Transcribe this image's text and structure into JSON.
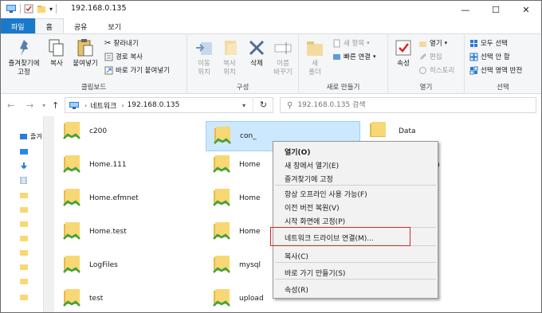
{
  "window": {
    "title": "192.168.0.135",
    "minimize_glyph": "—",
    "maximize_glyph": "☐",
    "close_glyph": "✕"
  },
  "ribbon_tabs": [
    {
      "label": "파일"
    },
    {
      "label": "홈"
    },
    {
      "label": "공유"
    },
    {
      "label": "보기"
    }
  ],
  "ribbon": {
    "clipboard": {
      "label": "클립보드",
      "pin": "즐겨찾기에\n고정",
      "copy": "복사",
      "paste": "붙여넣기",
      "cut": "잘라내기",
      "copy_path": "경로 복사",
      "paste_shortcut": "바로 가기 붙여넣기"
    },
    "organize": {
      "label": "구성",
      "move_to": "이동\n위치",
      "copy_to": "복사\n위치",
      "delete": "삭제",
      "rename": "이름\n바꾸기"
    },
    "new": {
      "label": "새로 만들기",
      "new_folder": "새\n폴더",
      "new_item": "새 항목",
      "easy_access": "빠른 연결"
    },
    "open": {
      "label": "열기",
      "properties": "속성",
      "open": "열기",
      "edit": "편집",
      "history": "히스토리"
    },
    "select": {
      "label": "선택",
      "select_all": "모두 선택",
      "select_none": "선택 안 함",
      "invert": "선택 영역 반전"
    }
  },
  "address": {
    "crumbs": [
      "네트워크",
      "192.168.0.135"
    ],
    "search_placeholder": "192.168.0.135 검색"
  },
  "nav_pane": {
    "items": [
      {
        "label": "즐겨",
        "icon": "star-icon"
      },
      {
        "label": "",
        "icon": "desktop-icon"
      },
      {
        "label": "",
        "icon": "download-icon"
      },
      {
        "label": "",
        "icon": "document-icon"
      },
      {
        "label": "",
        "icon": "folder-icon"
      },
      {
        "label": "",
        "icon": "folder-icon"
      },
      {
        "label": "",
        "icon": "folder-icon"
      },
      {
        "label": "",
        "icon": "folder-icon"
      },
      {
        "label": "",
        "icon": "folder-icon"
      },
      {
        "label": "",
        "icon": "folder-icon"
      }
    ]
  },
  "files": [
    {
      "name": "c200"
    },
    {
      "name": "con_"
    },
    {
      "name": "Data"
    },
    {
      "name": "Home.111"
    },
    {
      "name": "Home"
    },
    {
      "name": "h"
    },
    {
      "name": "Home.efmnet"
    },
    {
      "name": "Home"
    },
    {
      "name": "Home.test"
    },
    {
      "name": "Home"
    },
    {
      "name": "LogFiles"
    },
    {
      "name": "mysql"
    },
    {
      "name": "test"
    },
    {
      "name": "upload"
    }
  ],
  "context_menu": {
    "items": [
      {
        "label": "열기(O)",
        "bold": true
      },
      {
        "label": "새 창에서 열기(E)"
      },
      {
        "label": "즐겨찾기에 고정"
      },
      {
        "label": "항상 오프라인 사용 가능(F)"
      },
      {
        "label": "이전 버전 복원(V)"
      },
      {
        "label": "시작 화면에 고정(P)"
      },
      {
        "label": "네트워크 드라이브 연결(M)..."
      },
      {
        "label": "복사(C)"
      },
      {
        "label": "바로 가기 만들기(S)"
      },
      {
        "label": "속성(R)"
      }
    ]
  },
  "colors": {
    "accent": "#1979ca",
    "selection": "#cce8ff",
    "highlight_box": "#d9251d",
    "folder": "#f8d775",
    "folder_dark": "#e8b84a",
    "share_green": "#3ba33b"
  }
}
